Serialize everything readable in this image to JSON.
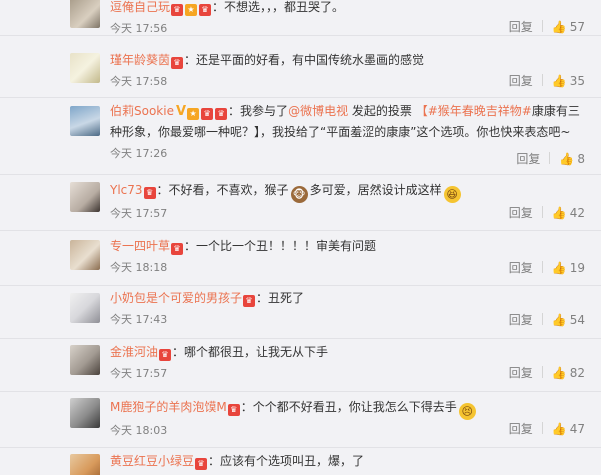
{
  "ui": {
    "reply": "回复"
  },
  "comments": [
    {
      "user": "逗俺自己玩",
      "sep": "：",
      "text": "不想选，，，都丑哭了。",
      "time": "今天 17:56",
      "likes": "57"
    },
    {
      "user": "瑾年龄葵茵",
      "sep": "：",
      "text": "还是平面的好看，有中国传统水墨画的感觉",
      "time": "今天 17:58",
      "likes": "35"
    },
    {
      "user": "伯莉Sookie",
      "sep": "：",
      "text_a": "我参与了",
      "link_a": "@微博电视",
      "text_b": " 发起的投票 ",
      "link_b": "【#猴年春晚吉祥物#",
      "text_c": "康康有三种形象，你最爱哪一种呢？】，我投给了“平面羞涩的康康”这个选项。你也快来表态吧~",
      "time": "今天 17:26",
      "likes": "8"
    },
    {
      "user": "Ylc73",
      "sep": "：",
      "text_a": "不好看，不喜欢，猴子",
      "emoji_a": "monkey-emoji",
      "text_b": "多可爱，居然设计成这样",
      "emoji_b": "laugh-emoji",
      "time": "今天 17:57",
      "likes": "42"
    },
    {
      "user": "专一四叶草",
      "sep": "：",
      "text": "一个比一个丑！！！！审美有问题",
      "time": "今天 18:18",
      "likes": "19"
    },
    {
      "user": "小奶包是个可爱的男孩子",
      "sep": "：",
      "text": "丑死了",
      "time": "今天 17:43",
      "likes": "54"
    },
    {
      "user": "金淮河油",
      "sep": "：",
      "text": "哪个都很丑，让我无从下手",
      "time": "今天 17:57",
      "likes": "82"
    },
    {
      "user": "M鹿狍子的羊肉泡馍M",
      "sep": "：",
      "text": "个个都不好看丑，你让我怎么下得去手",
      "emoji": "tired-emoji",
      "time": "今天 18:03",
      "likes": "47"
    },
    {
      "user": "黄豆红豆小绿豆",
      "sep": "：",
      "text": "应该有个选项叫丑，爆，了"
    }
  ],
  "colors": {
    "username": "#eb7350",
    "meta": "#808080",
    "background": "#f2f2f5"
  }
}
